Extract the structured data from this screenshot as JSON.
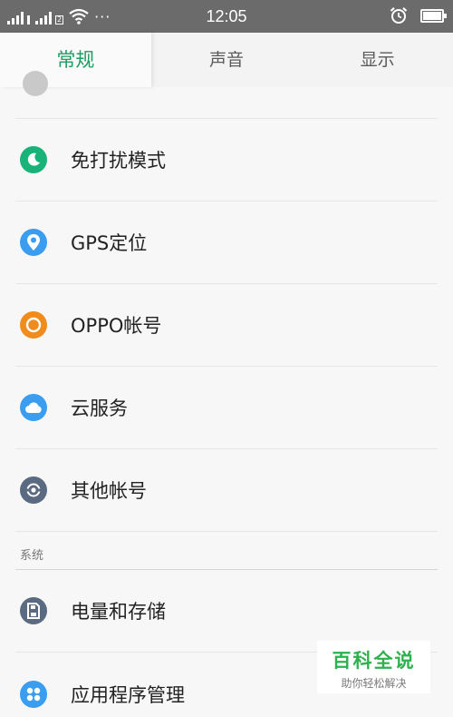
{
  "status_bar": {
    "sim1_badge": "",
    "sim2_badge": "2",
    "more_dots": "···",
    "time": "12:05",
    "battery_level": 0.9
  },
  "tabs": [
    {
      "label": "常规",
      "active": true
    },
    {
      "label": "声音",
      "active": false
    },
    {
      "label": "显示",
      "active": false
    }
  ],
  "list": {
    "items_top": [
      {
        "label": "免打扰模式",
        "icon": "moon-icon",
        "color": "#19b37a"
      },
      {
        "label": "GPS定位",
        "icon": "location-pin-icon",
        "color": "#3a9df0"
      },
      {
        "label": "OPPO帐号",
        "icon": "account-circle-icon",
        "color": "#f08c1e"
      },
      {
        "label": "云服务",
        "icon": "cloud-icon",
        "color": "#3a9df0"
      },
      {
        "label": "其他帐号",
        "icon": "sync-account-icon",
        "color": "#5a6a80"
      }
    ],
    "section_system": "系统",
    "items_bottom": [
      {
        "label": "电量和存储",
        "icon": "storage-icon",
        "color": "#5a6a80"
      },
      {
        "label": "应用程序管理",
        "icon": "apps-icon",
        "color": "#3a9df0"
      }
    ]
  },
  "watermark": {
    "title": "百科全说",
    "subtitle": "助你轻松解决"
  }
}
